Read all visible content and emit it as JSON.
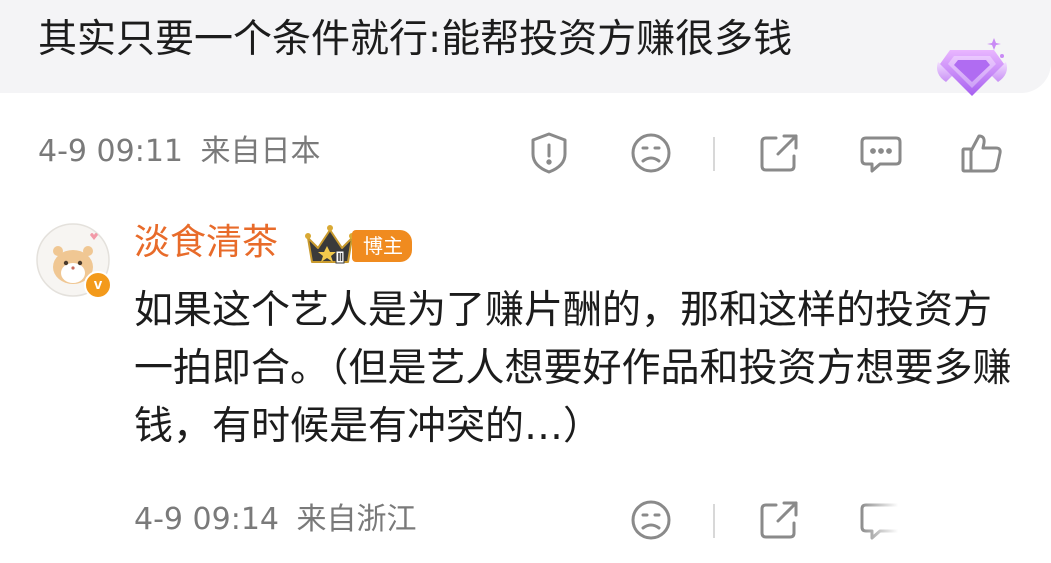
{
  "comment": {
    "text": "其实只要一个条件就行:能帮投资方赚很多钱",
    "time": "4-9 09:11",
    "source": "来自日本"
  },
  "reply": {
    "username": "淡食清茶",
    "role_badge": "博主",
    "text": "如果这个艺人是为了赚片酬的，那和这样的投资方一拍即合。（但是艺人想要好作品和投资方想要多赚钱，有时候是有冲突的…）",
    "time": "4-9 09:14",
    "source": "来自浙江"
  },
  "icons": {
    "report": "warning-shield-icon",
    "dislike": "frown-face-icon",
    "share": "share-icon",
    "comment": "comment-icon",
    "like": "thumbs-up-icon",
    "badge": "diamond-gem-icon",
    "crown": "crown-icon",
    "verified": "verified-v-icon"
  },
  "colors": {
    "username": "#e86b2a",
    "role_badge": "#f08b1f",
    "meta_text": "#7a7a7a",
    "icon_gray": "#8a8a8a",
    "bubble_bg": "#f4f4f6"
  }
}
